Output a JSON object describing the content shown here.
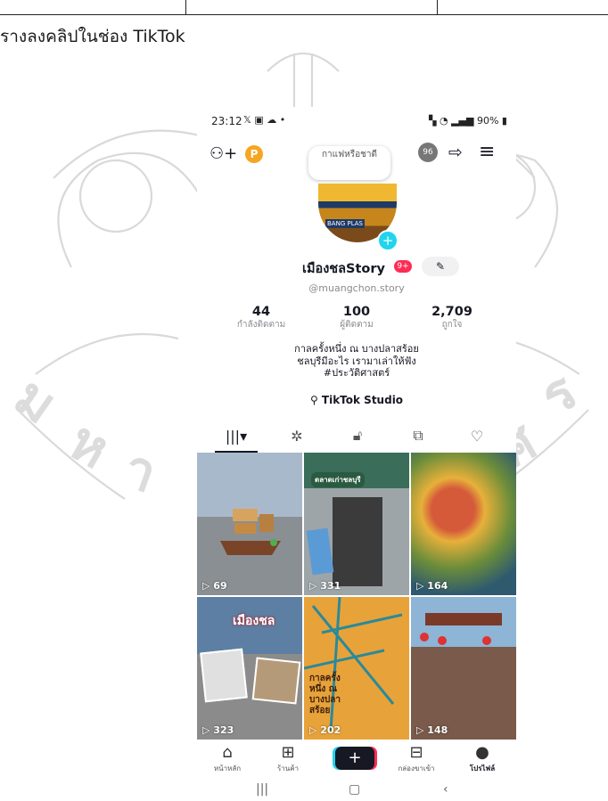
{
  "document": {
    "caption": "รางลงคลิปในช่อง TikTok"
  },
  "status_bar": {
    "time": "23:12",
    "battery": "90%"
  },
  "profile": {
    "note": "กาแฟหรือชาดี",
    "avatar_sign": "BANG PLAS",
    "avatar_count": "96",
    "username": "เมืองชลStory",
    "name_badge": "9+",
    "handle": "@muangchon.story",
    "stats": [
      {
        "value": "44",
        "label": "กำลังติดตาม"
      },
      {
        "value": "100",
        "label": "ผู้ติดตาม"
      },
      {
        "value": "2,709",
        "label": "ถูกใจ"
      }
    ],
    "bio_lines": [
      "กาลครั้งหนึ่ง ณ บางปลาสร้อย",
      "ชลบุรีมีอะไร เรามาเล่าให้ฟัง",
      "#ประวัติศาสตร์"
    ],
    "studio_label": "TikTok Studio"
  },
  "tabs": [
    {
      "icon": "grid-icon",
      "glyph": "|||▾"
    },
    {
      "icon": "repost-icon",
      "glyph": "⟲"
    },
    {
      "icon": "lock-icon",
      "glyph": "⊡"
    },
    {
      "icon": "saved-icon",
      "glyph": "⧉"
    },
    {
      "icon": "liked-icon",
      "glyph": "♡"
    }
  ],
  "videos": [
    {
      "views": "69"
    },
    {
      "views": "331",
      "overlay": "ตลาดเก่าชลบุรี"
    },
    {
      "views": "164"
    },
    {
      "views": "323",
      "overlay": "เมืองชล"
    },
    {
      "views": "202",
      "overlay": "กาลครั้งหนึ่ง ณ บางปลาสร้อย"
    },
    {
      "views": "148"
    }
  ],
  "bottom_nav": [
    {
      "label": "หน้าหลัก",
      "icon": "home-icon"
    },
    {
      "label": "ร้านค้า",
      "icon": "shop-icon"
    },
    {
      "label": "",
      "icon": "create-icon"
    },
    {
      "label": "กล่องขาเข้า",
      "icon": "inbox-icon"
    },
    {
      "label": "โปรไฟล์",
      "icon": "profile-icon"
    }
  ],
  "colors": {
    "accent_red": "#fe2c55",
    "accent_cyan": "#20d5ec",
    "text_primary": "#161823",
    "text_secondary": "#8a8b91"
  }
}
